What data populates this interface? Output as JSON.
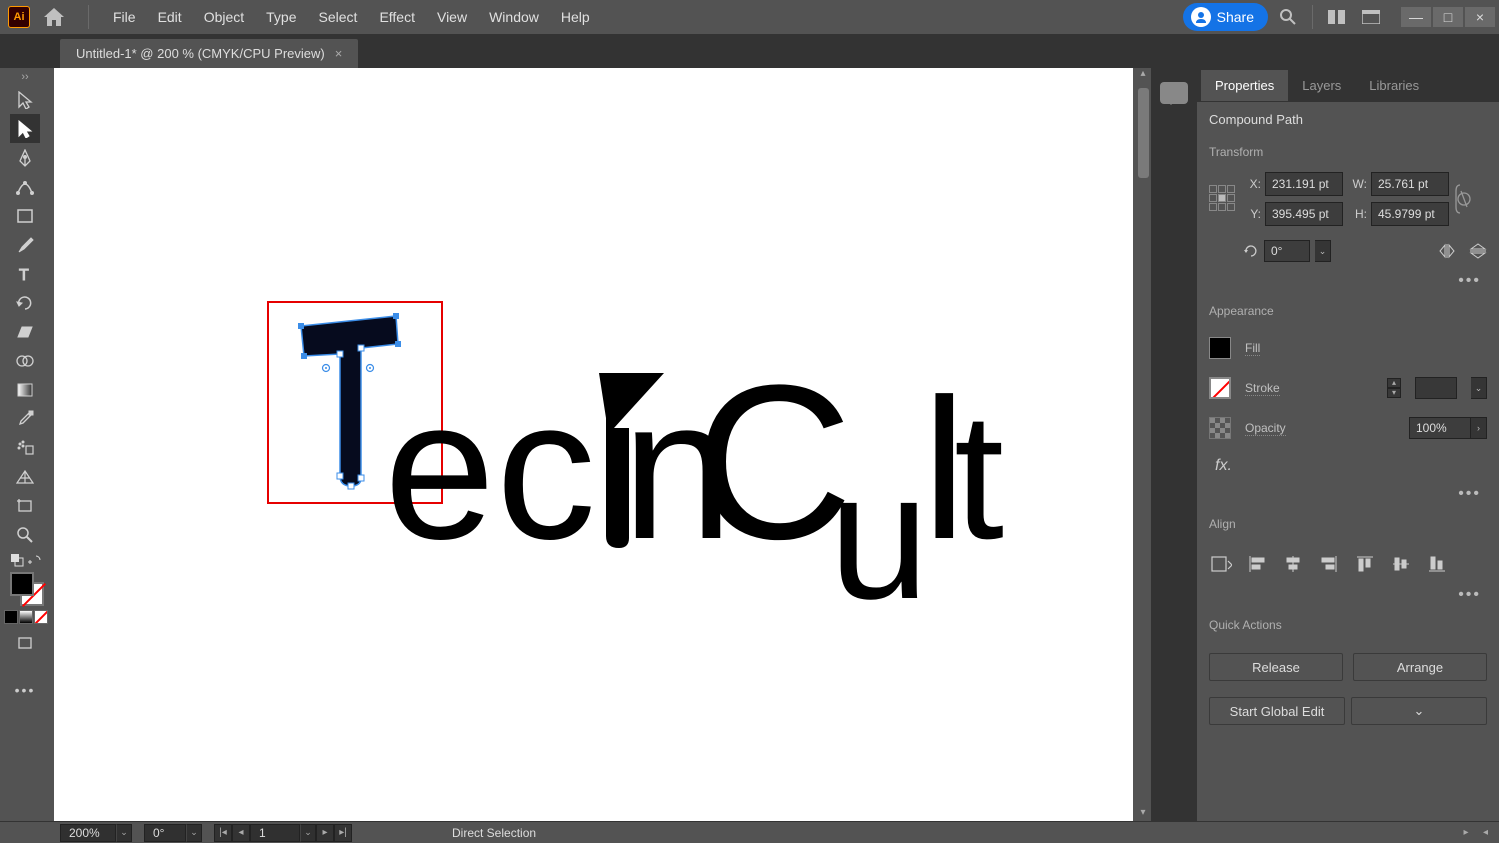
{
  "topbar": {
    "logo": "Ai",
    "menus": [
      "File",
      "Edit",
      "Object",
      "Type",
      "Select",
      "Effect",
      "View",
      "Window",
      "Help"
    ],
    "share": "Share"
  },
  "tab": {
    "title": "Untitled-1* @ 200 % (CMYK/CPU Preview)",
    "close": "×"
  },
  "canvas": {
    "text": "echCult"
  },
  "panel": {
    "tabs": [
      "Properties",
      "Layers",
      "Libraries"
    ],
    "selection": "Compound Path",
    "transform": {
      "title": "Transform",
      "xlabel": "X:",
      "ylabel": "Y:",
      "wlabel": "W:",
      "hlabel": "H:",
      "x": "231.191 pt",
      "y": "395.495 pt",
      "w": "25.761 pt",
      "h": "45.9799 pt",
      "rot": "0°"
    },
    "appearance": {
      "title": "Appearance",
      "fill": "Fill",
      "stroke": "Stroke",
      "opacity": "Opacity",
      "opval": "100%",
      "fx": "fx."
    },
    "align": {
      "title": "Align"
    },
    "quick": {
      "title": "Quick Actions",
      "release": "Release",
      "arrange": "Arrange",
      "global": "Start Global Edit"
    }
  },
  "status": {
    "zoom": "200%",
    "rot": "0°",
    "page": "1",
    "mode": "Direct Selection"
  },
  "win": {
    "min": "—",
    "max": "□",
    "close": "×"
  }
}
